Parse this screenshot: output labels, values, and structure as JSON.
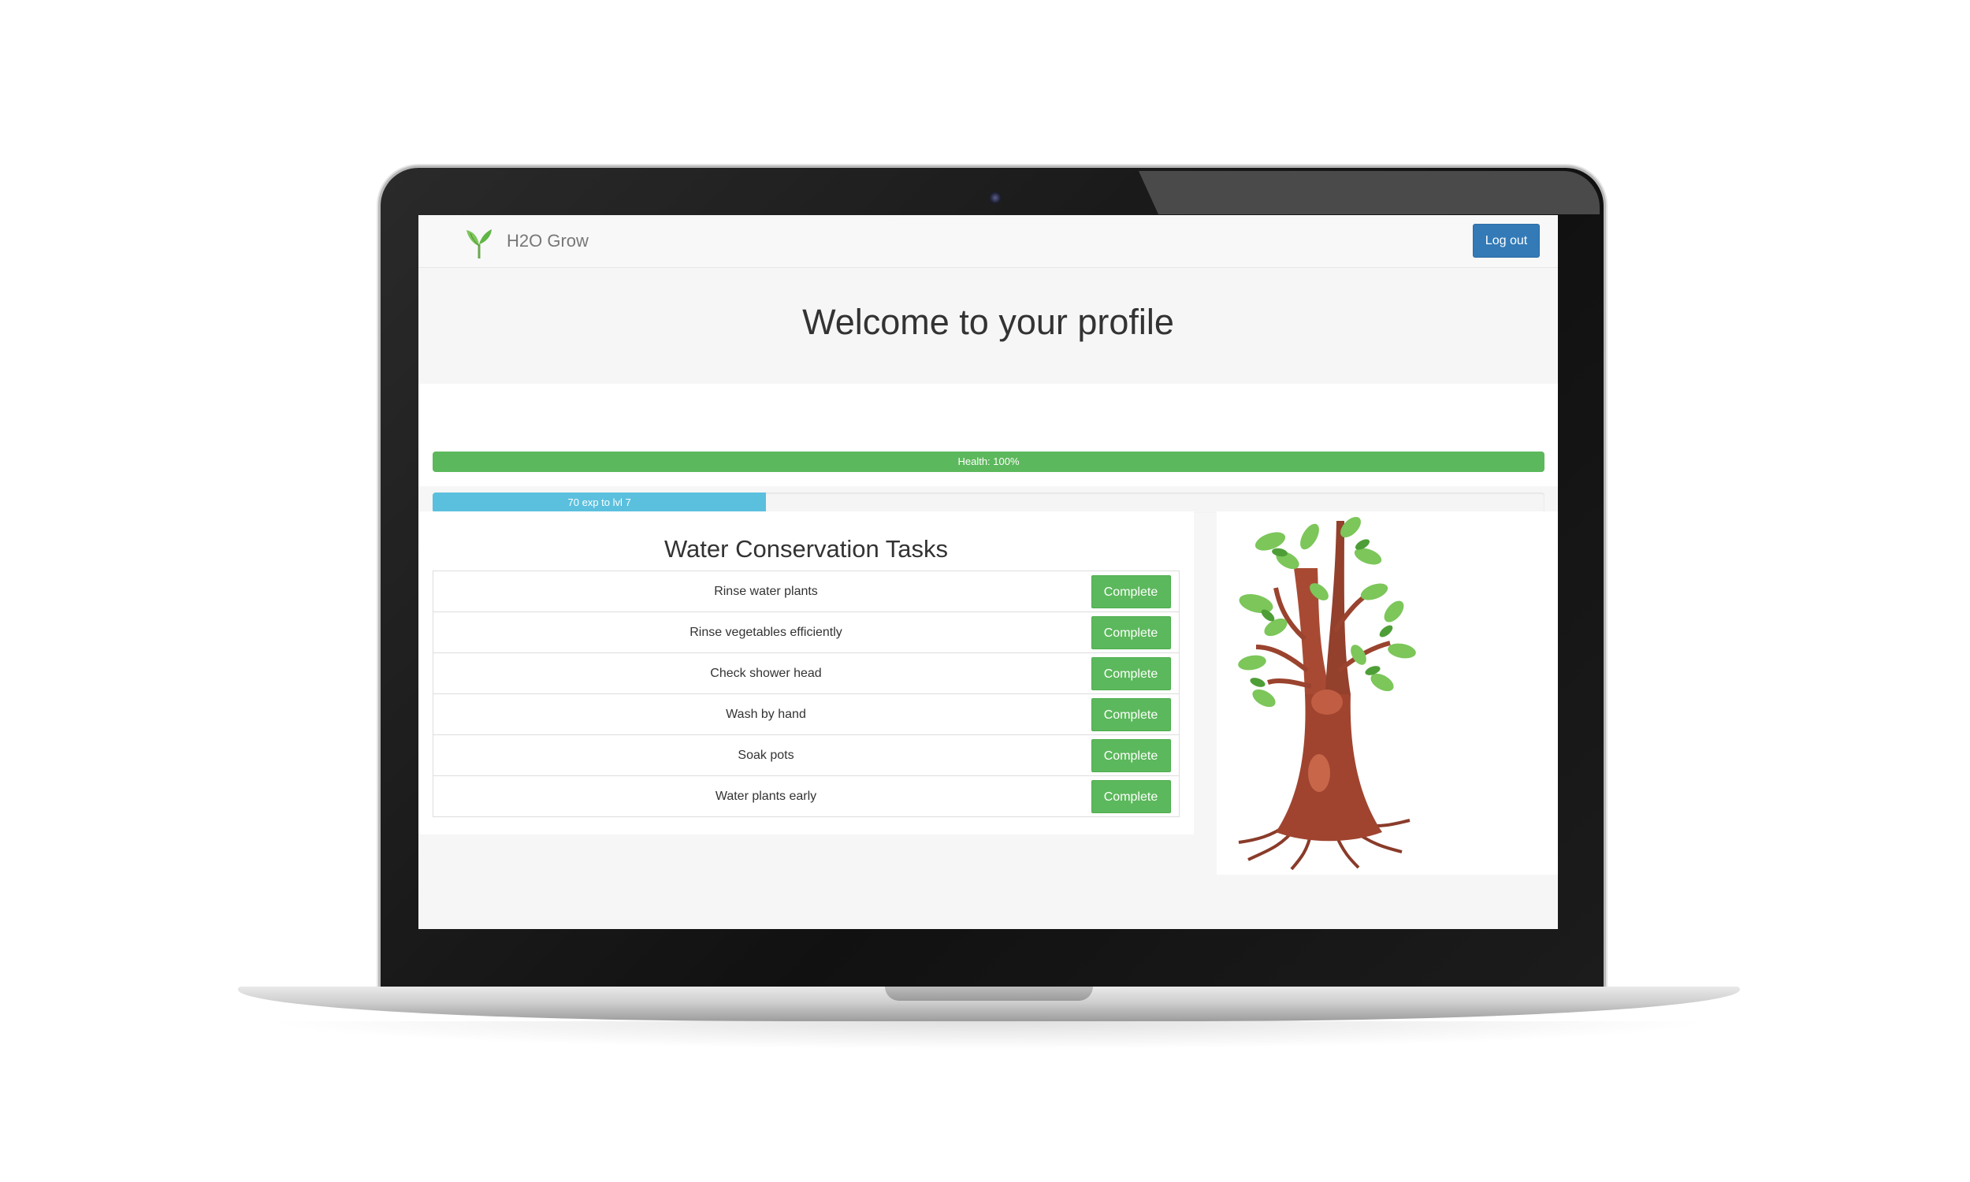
{
  "navbar": {
    "brand_name": "H2O Grow",
    "brand_icon": "sprout-icon",
    "logout_label": "Log out"
  },
  "page": {
    "title": "Welcome to your profile"
  },
  "stats": {
    "health": {
      "label": "Health: 100%",
      "percent": 100,
      "color": "#5cb85c"
    },
    "experience": {
      "label": "70 exp to lvl 7",
      "percent": 30,
      "color": "#5bc0de"
    }
  },
  "tasks": {
    "title": "Water Conservation Tasks",
    "button_label": "Complete",
    "items": [
      {
        "name": "Rinse water plants"
      },
      {
        "name": "Rinse vegetables efficiently"
      },
      {
        "name": "Check shower head"
      },
      {
        "name": "Wash by hand"
      },
      {
        "name": "Soak pots"
      },
      {
        "name": "Water plants early"
      }
    ]
  },
  "tree": {
    "image": "tree-illustration"
  },
  "colors": {
    "primary": "#337ab7",
    "success": "#5cb85c",
    "info": "#5bc0de"
  }
}
